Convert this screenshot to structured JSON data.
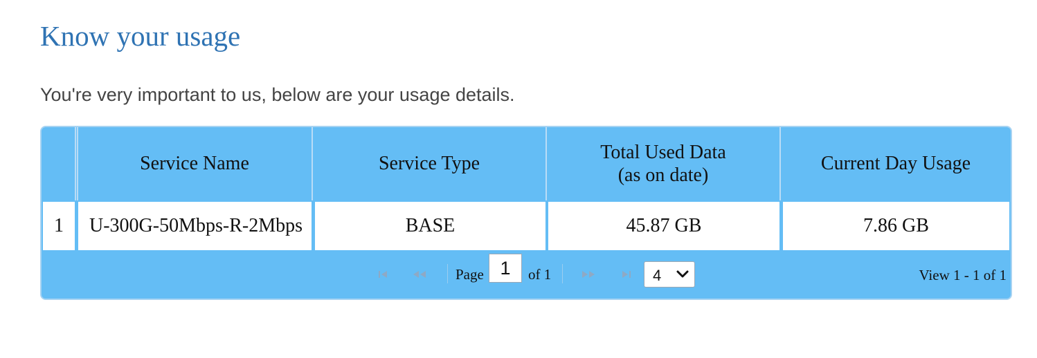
{
  "page": {
    "title": "Know your usage",
    "subtitle": "You're very important to us, below are your usage details."
  },
  "table": {
    "columns": [
      {
        "label": "Service Name"
      },
      {
        "label": "Service Type"
      },
      {
        "label": "Total Used Data\n(as on date)"
      },
      {
        "label": "Current Day Usage"
      }
    ],
    "rows": [
      {
        "row_number": "1",
        "service_name": "U-300G-50Mbps-R-2Mbps",
        "service_type": "BASE",
        "total_used_data": "45.87 GB",
        "current_day_usage": "7.86 GB"
      }
    ]
  },
  "pager": {
    "first_icon": "first-page-icon",
    "prev_icon": "previous-page-icon",
    "next_icon": "next-page-icon",
    "last_icon": "last-page-icon",
    "page_label": "Page",
    "current_page": "1",
    "of_label": "of 1",
    "rows_per_page": "4",
    "view_text": "View 1 - 1 of 1"
  },
  "colors": {
    "title": "#2f73b3",
    "grid_background": "#64bdf5",
    "grid_border": "#a8d3f2"
  }
}
